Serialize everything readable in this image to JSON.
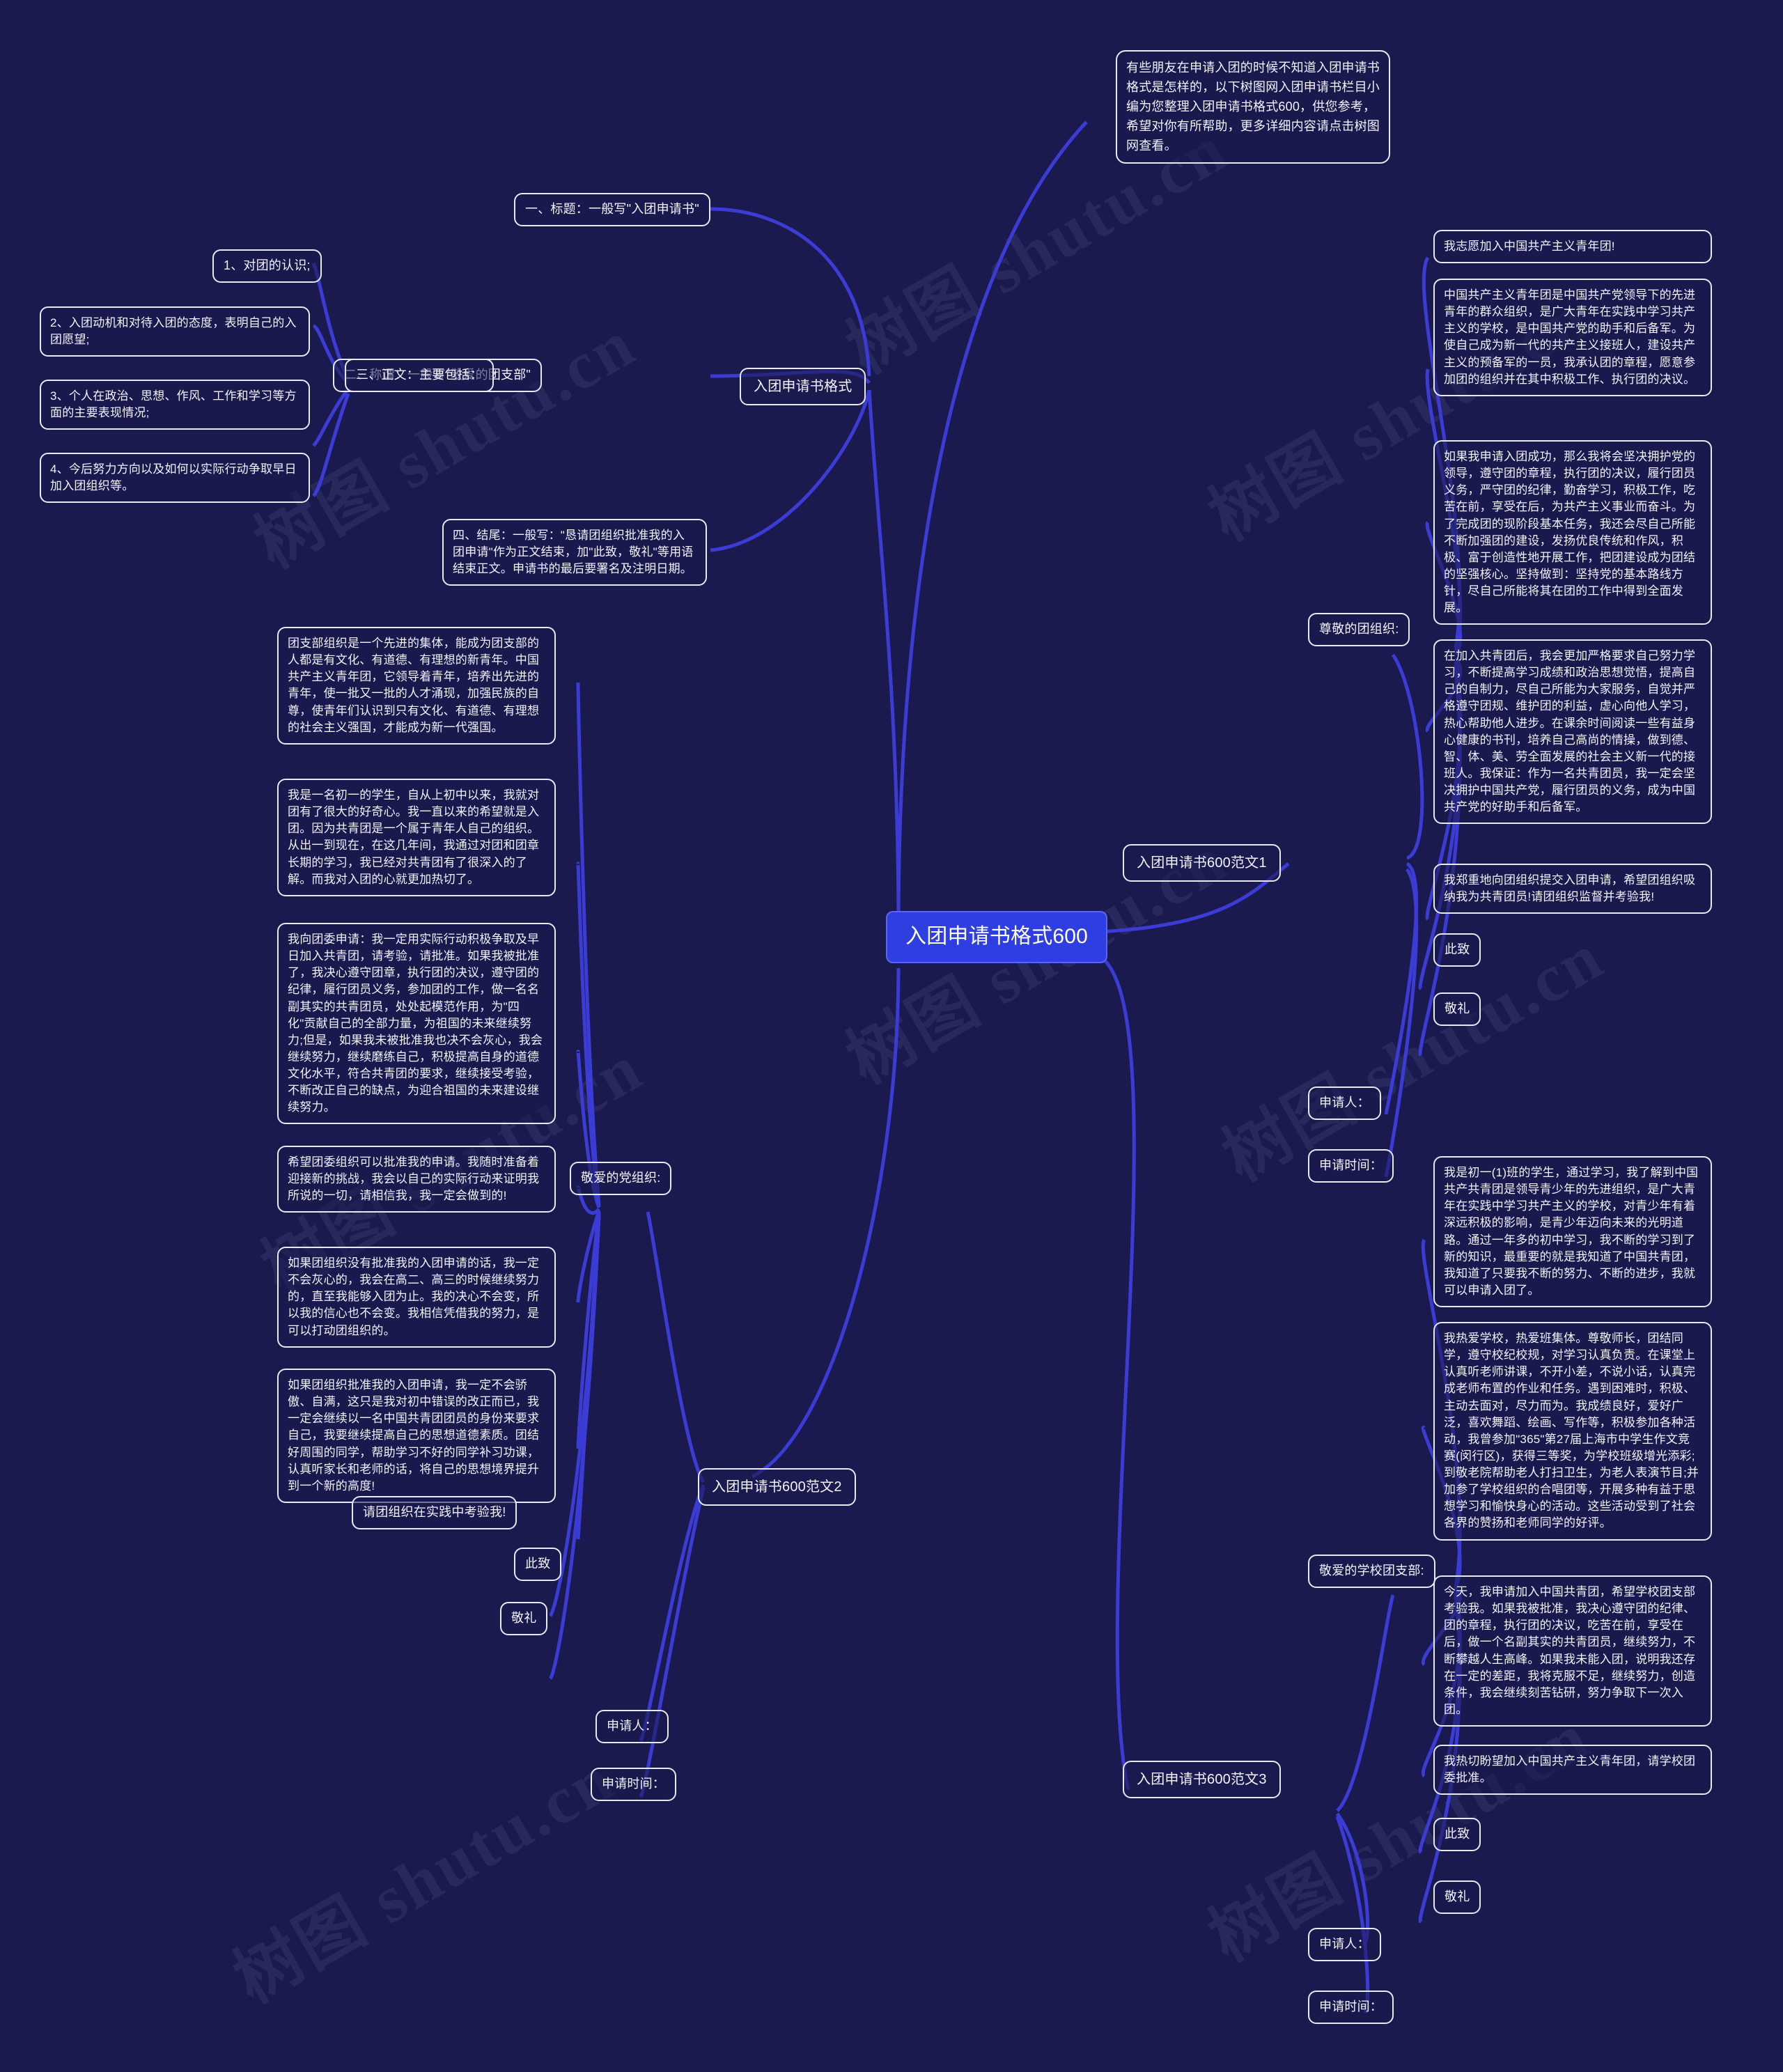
{
  "theme": {
    "background": "#1a1a4e",
    "node_border": "#e8eaf6",
    "node_text": "#f2f3fb",
    "root_fill": "#2f3ee0",
    "link_color": "#3b3bd6"
  },
  "watermark": "树图 shutu.cn",
  "root": {
    "label": "入团申请书格式600"
  },
  "intro": {
    "text": "有些朋友在申请入团的时候不知道入团申请书格式是怎样的，以下树图网入团申请书栏目小编为您整理入团申请书格式600，供您参考，希望对你有所帮助，更多详细内容请点击树图网查看。"
  },
  "branches": [
    {
      "id": "format",
      "label": "入团申请书格式",
      "children": [
        {
          "id": "t1",
          "label": "一、标题：一般写\"入团申请书\""
        },
        {
          "id": "t2",
          "label": "二、称谓：一般写\"敬爱的团支部\""
        },
        {
          "id": "t3",
          "label": "三、正文：主要包括：",
          "children": [
            {
              "id": "t3a",
              "label": "1、对团的认识;"
            },
            {
              "id": "t3b",
              "label": "2、入团动机和对待入团的态度，表明自己的入团愿望;"
            },
            {
              "id": "t3c",
              "label": "3、个人在政治、思想、作风、工作和学习等方面的主要表现情况;"
            },
            {
              "id": "t3d",
              "label": "4、今后努力方向以及如何以实际行动争取早日加入团组织等。"
            }
          ]
        },
        {
          "id": "t4",
          "label": "四、结尾：一般写：\"恳请团组织批准我的入团申请\"作为正文结束，加\"此致，敬礼\"等用语结束正文。申请书的最后要署名及注明日期。"
        }
      ]
    },
    {
      "id": "fanwen1",
      "label": "入团申请书600范文1",
      "children": [
        {
          "id": "f1-head",
          "label": "尊敬的团组织:",
          "children": [
            {
              "id": "f1-p1",
              "label": "我志愿加入中国共产主义青年团!"
            },
            {
              "id": "f1-p2",
              "label": "中国共产主义青年团是中国共产党领导下的先进青年的群众组织，是广大青年在实践中学习共产主义的学校，是中国共产党的助手和后备军。为使自己成为新一代的共产主义接班人，建设共产主义的预备军的一员，我承认团的章程，愿意参加团的组织并在其中积极工作、执行团的决议。"
            },
            {
              "id": "f1-p3",
              "label": "如果我申请入团成功，那么我将会坚决拥护党的领导，遵守团的章程，执行团的决议，履行团员义务，严守团的纪律，勤奋学习，积极工作，吃苦在前，享受在后，为共产主义事业而奋斗。为了完成团的现阶段基本任务，我还会尽自己所能不断加强团的建设，发扬优良传统和作风，积极、富于创造性地开展工作，把团建设成为团结的坚强核心。坚持做到：坚持党的基本路线方针，尽自己所能将其在团的工作中得到全面发展。"
            },
            {
              "id": "f1-p4",
              "label": "在加入共青团后，我会更加严格要求自己努力学习，不断提高学习成绩和政治思想觉悟，提高自己的自制力，尽自己所能为大家服务，自觉并严格遵守团规、维护团的利益，虚心向他人学习，热心帮助他人进步。在课余时间阅读一些有益身心健康的书刊，培养自己高尚的情操，做到德、智、体、美、劳全面发展的社会主义新一代的接班人。我保证：作为一名共青团员，我一定会坚决拥护中国共产党，履行团员的义务，成为中国共产党的好助手和后备军。"
            },
            {
              "id": "f1-p5",
              "label": "我郑重地向团组织提交入团申请，希望团组织吸纳我为共青团员!请团组织监督并考验我!"
            },
            {
              "id": "f1-p6",
              "label": "此致"
            },
            {
              "id": "f1-p7",
              "label": "敬礼"
            }
          ]
        },
        {
          "id": "f1-sig",
          "label": "申请人："
        },
        {
          "id": "f1-date",
          "label": "申请时间："
        }
      ]
    },
    {
      "id": "fanwen2",
      "label": "入团申请书600范文2",
      "children": [
        {
          "id": "f2-head",
          "label": "敬爱的党组织:",
          "children": [
            {
              "id": "f2-p1",
              "label": "团支部组织是一个先进的集体，能成为团支部的人都是有文化、有道德、有理想的新青年。中国共产主义青年团，它领导着青年，培养出先进的青年，使一批又一批的人才涌现，加强民族的自尊，使青年们认识到只有文化、有道德、有理想的社会主义强国，才能成为新一代强国。"
            },
            {
              "id": "f2-p2",
              "label": "我是一名初一的学生，自从上初中以来，我就对团有了很大的好奇心。我一直以来的希望就是入团。因为共青团是一个属于青年人自己的组织。从出一到现在，在这几年间，我通过对团和团章长期的学习，我已经对共青团有了很深入的了解。而我对入团的心就更加热切了。"
            },
            {
              "id": "f2-p3",
              "label": "我向团委申请：我一定用实际行动积极争取及早日加入共青团，请考验，请批准。如果我被批准了，我决心遵守团章，执行团的决议，遵守团的纪律，履行团员义务，参加团的工作，做一名名副其实的共青团员，处处起模范作用，为\"四化\"贡献自己的全部力量，为祖国的未来继续努力;但是，如果我未被批准我也决不会灰心，我会继续努力，继续磨练自己，积极提高自身的道德文化水平，符合共青团的要求，继续接受考验，不断改正自己的缺点，为迎合祖国的未来建设继续努力。"
            },
            {
              "id": "f2-p4",
              "label": "希望团委组织可以批准我的申请。我随时准备着迎接新的挑战，我会以自己的实际行动来证明我所说的一切，请相信我，我一定会做到的!"
            },
            {
              "id": "f2-p5",
              "label": "如果团组织没有批准我的入团申请的话，我一定不会灰心的，我会在高二、高三的时候继续努力的，直至我能够入团为止。我的决心不会变，所以我的信心也不会变。我相信凭借我的努力，是可以打动团组织的。"
            },
            {
              "id": "f2-p6",
              "label": "如果团组织批准我的入团申请，我一定不会骄傲、自满，这只是我对初中错误的改正而已，我一定会继续以一名中国共青团团员的身份来要求自己，我要继续提高自己的思想道德素质。团结好周围的同学，帮助学习不好的同学补习功课，认真听家长和老师的话，将自己的思想境界提升到一个新的高度!"
            },
            {
              "id": "f2-p7",
              "label": "请团组织在实践中考验我!"
            },
            {
              "id": "f2-p8",
              "label": "此致"
            },
            {
              "id": "f2-p9",
              "label": "敬礼"
            }
          ]
        },
        {
          "id": "f2-sig",
          "label": "申请人："
        },
        {
          "id": "f2-date",
          "label": "申请时间："
        }
      ]
    },
    {
      "id": "fanwen3",
      "label": "入团申请书600范文3",
      "children": [
        {
          "id": "f3-head",
          "label": "敬爱的学校团支部:",
          "children": [
            {
              "id": "f3-p1",
              "label": "我是初一(1)班的学生，通过学习，我了解到中国共产共青团是领导青少年的先进组织，是广大青年在实践中学习共产主义的学校，对青少年有着深远积极的影响，是青少年迈向未来的光明道路。通过一年多的初中学习，我不断的学习到了新的知识，最重要的就是我知道了中国共青团，我知道了只要我不断的努力、不断的进步，我就可以申请入团了。"
            },
            {
              "id": "f3-p2",
              "label": "我热爱学校，热爱班集体。尊敬师长，团结同学，遵守校纪校规，对学习认真负责。在课堂上认真听老师讲课，不开小差，不说小话，认真完成老师布置的作业和任务。遇到困难时，积极、主动去面对，尽力而为。我成绩良好，爱好广泛，喜欢舞蹈、绘画、写作等，积极参加各种活动，我曾参加\"365\"第27届上海市中学生作文竞赛(闵行区)，获得三等奖，为学校班级增光添彩;到敬老院帮助老人打扫卫生，为老人表演节目;并加参了学校组织的合唱团等，开展多种有益于思想学习和愉快身心的活动。这些活动受到了社会各界的赞扬和老师同学的好评。"
            },
            {
              "id": "f3-p3",
              "label": "今天，我申请加入中国共青团，希望学校团支部考验我。如果我被批准，我决心遵守团的纪律、团的章程，执行团的决议，吃苦在前，享受在后，做一个名副其实的共青团员，继续努力，不断攀越人生高峰。如果我未能入团，说明我还存在一定的差距，我将克服不足，继续努力，创造条件，我会继续刻苦钻研，努力争取下一次入团。"
            },
            {
              "id": "f3-p4",
              "label": "我热切盼望加入中国共产主义青年团，请学校团委批准。"
            },
            {
              "id": "f3-p5",
              "label": "此致"
            },
            {
              "id": "f3-p6",
              "label": "敬礼"
            }
          ]
        },
        {
          "id": "f3-sig",
          "label": "申请人："
        },
        {
          "id": "f3-date",
          "label": "申请时间："
        }
      ]
    }
  ]
}
